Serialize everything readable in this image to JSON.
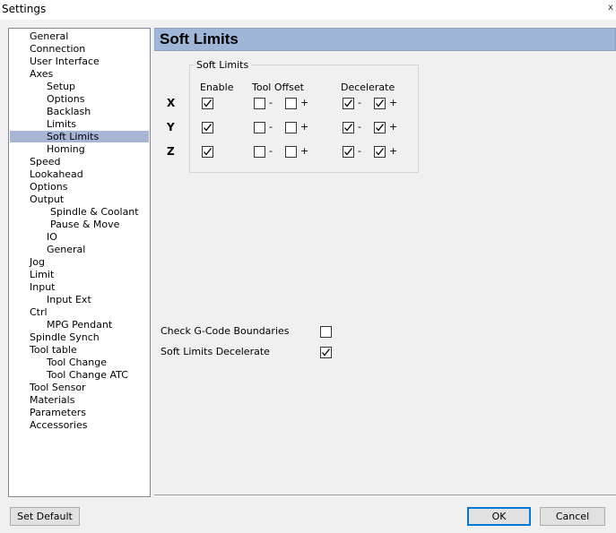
{
  "window": {
    "title": "Settings",
    "close_glyph": "x"
  },
  "tree": {
    "items": [
      {
        "label": "General"
      },
      {
        "label": "Connection"
      },
      {
        "label": "User Interface"
      },
      {
        "label": "Axes"
      },
      {
        "label": "Setup"
      },
      {
        "label": "Options"
      },
      {
        "label": "Backlash"
      },
      {
        "label": "Limits"
      },
      {
        "label": "Soft Limits",
        "selected": true
      },
      {
        "label": "Homing"
      },
      {
        "label": "Speed"
      },
      {
        "label": "Lookahead"
      },
      {
        "label": "Options"
      },
      {
        "label": "Output"
      },
      {
        "label": "Spindle & Coolant"
      },
      {
        "label": "Pause & Move"
      },
      {
        "label": "IO"
      },
      {
        "label": "General"
      },
      {
        "label": "Jog"
      },
      {
        "label": "Limit"
      },
      {
        "label": "Input"
      },
      {
        "label": "Input Ext"
      },
      {
        "label": "Ctrl"
      },
      {
        "label": "MPG Pendant"
      },
      {
        "label": "Spindle Synch"
      },
      {
        "label": "Tool table"
      },
      {
        "label": "Tool Change"
      },
      {
        "label": "Tool Change ATC"
      },
      {
        "label": "Tool Sensor"
      },
      {
        "label": "Materials"
      },
      {
        "label": "Parameters"
      },
      {
        "label": "Accessories"
      }
    ]
  },
  "panel": {
    "header": "Soft Limits",
    "group_title": "Soft Limits",
    "columns": {
      "enable": "Enable",
      "tool_offset": "Tool Offset",
      "decelerate": "Decelerate"
    },
    "minus": "-",
    "plus": "+",
    "axes": [
      {
        "name": "X",
        "enable": true,
        "offset_minus": false,
        "offset_plus": false,
        "decel_minus": true,
        "decel_plus": true
      },
      {
        "name": "Y",
        "enable": true,
        "offset_minus": false,
        "offset_plus": false,
        "decel_minus": true,
        "decel_plus": true
      },
      {
        "name": "Z",
        "enable": true,
        "offset_minus": false,
        "offset_plus": false,
        "decel_minus": true,
        "decel_plus": true
      }
    ],
    "check_gcode_label": "Check G-Code Boundaries",
    "check_gcode_checked": false,
    "soft_decel_label": "Soft Limits Decelerate",
    "soft_decel_checked": true
  },
  "buttons": {
    "set_default": "Set Default",
    "ok": "OK",
    "cancel": "Cancel"
  }
}
